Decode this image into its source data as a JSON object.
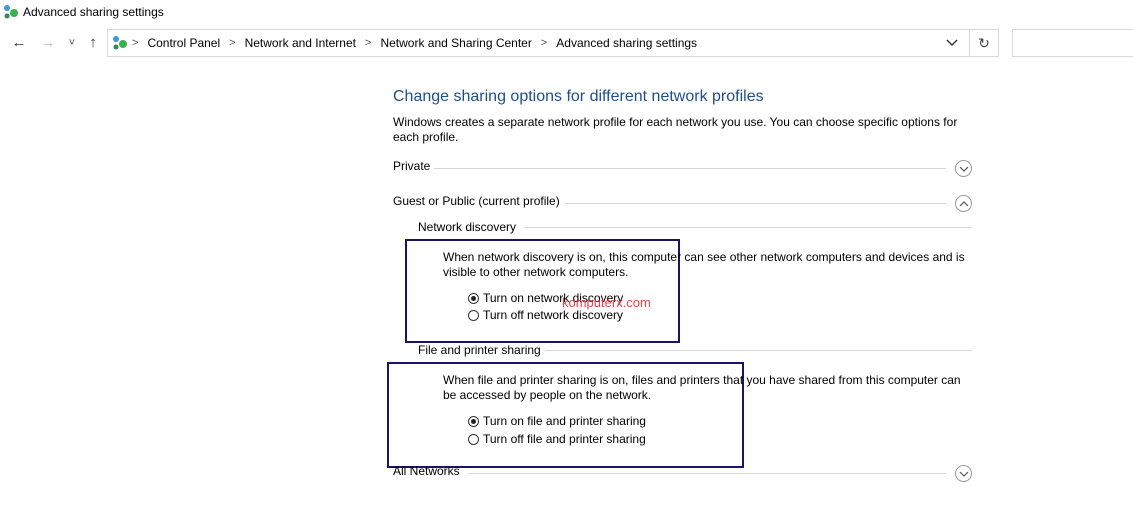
{
  "window": {
    "title": "Advanced sharing settings"
  },
  "nav": {
    "back_glyph": "←",
    "forward_glyph": "→",
    "recent_glyph": "˅",
    "up_glyph": "↑"
  },
  "address": {
    "crumbs": [
      "Control Panel",
      "Network and Internet",
      "Network and Sharing Center",
      "Advanced sharing settings"
    ],
    "separator": ">",
    "refresh_glyph": "↻"
  },
  "content": {
    "heading": "Change sharing options for different network profiles",
    "intro": "Windows creates a separate network profile for each network you use. You can choose specific options for each profile.",
    "profiles": {
      "private": {
        "label": "Private",
        "state": "collapsed"
      },
      "guest": {
        "label": "Guest or Public (current profile)",
        "state": "expanded"
      },
      "all": {
        "label": "All Networks",
        "state": "collapsed"
      }
    },
    "network_discovery": {
      "label": "Network discovery",
      "description": "When network discovery is on, this computer can see other network computers and devices and is visible to other network computers.",
      "on_label": "Turn on network discovery",
      "off_label": "Turn off network discovery",
      "selected": "on"
    },
    "file_sharing": {
      "label": "File and printer sharing",
      "description": "When file and printer sharing is on, files and printers that you have shared from this computer can be accessed by people on the network.",
      "on_label": "Turn on file and printer sharing",
      "off_label": "Turn off file and printer sharing",
      "selected": "on"
    }
  },
  "watermark": "komputerx.com",
  "colors": {
    "heading": "#1e4e8c",
    "highlight_box": "#1a1466",
    "watermark": "#e03030"
  }
}
